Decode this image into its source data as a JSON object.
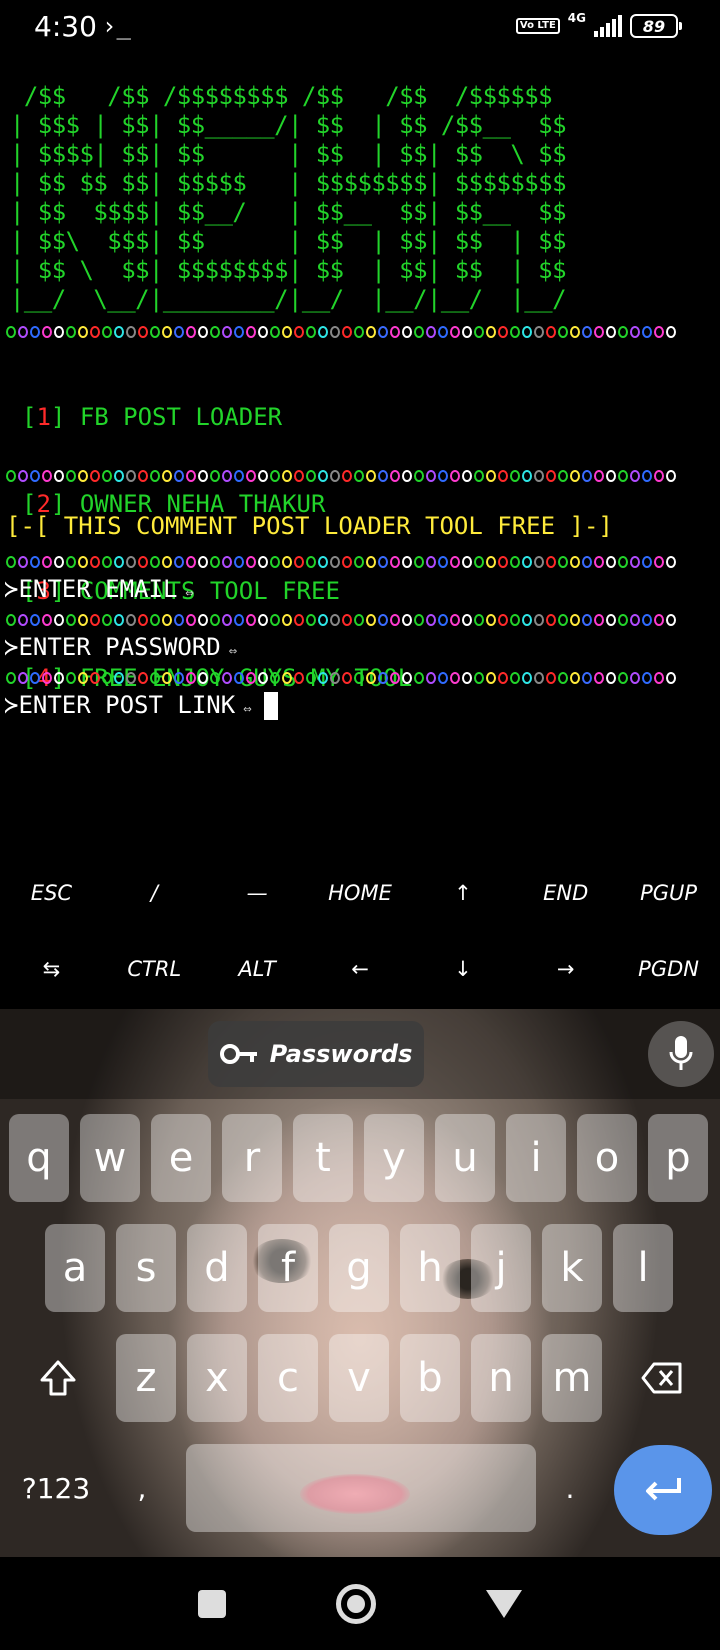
{
  "status_bar": {
    "time": "4:30",
    "terminal_glyph": "›_",
    "volte": "Vo LTE",
    "network": "4G",
    "battery": "89"
  },
  "terminal": {
    "banner_lines": [
      " /$$   /$$ /$$$$$$$$ /$$   /$$  /$$$$$$",
      "| $$$ | $$| $$_____/| $$  | $$ /$$__  $$",
      "| $$$$| $$| $$      | $$  | $$| $$  \\ $$",
      "| $$ $$ $$| $$$$$   | $$$$$$$$| $$$$$$$$",
      "| $$  $$$$| $$__/   | $$__  $$| $$__  $$",
      "| $$\\  $$$| $$      | $$  | $$| $$  | $$",
      "| $$ \\  $$| $$$$$$$$| $$  | $$| $$  | $$",
      "|__/  \\__/|________/|__/  |__/|__/  |__/"
    ],
    "menu": [
      {
        "num": "1",
        "label": "FB POST LOADER"
      },
      {
        "num": "2",
        "label": "OWNER NEHA THAKUR"
      },
      {
        "num": "3",
        "label": "COMMENTS TOOL FREE"
      },
      {
        "num": "4",
        "label": "FREE ENJOY GUYS MY TOOL"
      }
    ],
    "headline": "[-[ THIS COMMENT POST LOADER TOOL FREE ]-]",
    "prompts": {
      "email": "ENTER EMAIL",
      "password": "ENTER PASSWORD",
      "post_link": "ENTER POST LINK"
    },
    "prompt_arrow": "≻",
    "prompt_symbol": "⇔",
    "dot_colors": [
      "#22d42a",
      "#b04cff",
      "#2f6bff",
      "#ff3ad0",
      "#ffffff",
      "#22d42a",
      "#ffeb3b",
      "#ff2a2a",
      "#22d42a",
      "#2ee6e6",
      "#888888",
      "#ff2a2a",
      "#22d42a",
      "#ffeb3b",
      "#3a6bff",
      "#ff3ad0",
      "#ffffff"
    ]
  },
  "extra_keys": {
    "row1": [
      "ESC",
      "/",
      "—",
      "HOME",
      "↑",
      "END",
      "PGUP"
    ],
    "row2": [
      "⇆",
      "CTRL",
      "ALT",
      "←",
      "↓",
      "→",
      "PGDN"
    ]
  },
  "keyboard": {
    "passwords_label": "Passwords",
    "row1": [
      "q",
      "w",
      "e",
      "r",
      "t",
      "y",
      "u",
      "i",
      "o",
      "p"
    ],
    "row2": [
      "a",
      "s",
      "d",
      "f",
      "g",
      "h",
      "j",
      "k",
      "l"
    ],
    "row3": [
      "z",
      "x",
      "c",
      "v",
      "b",
      "n",
      "m"
    ],
    "symbols_label": "?123",
    "comma": ",",
    "period": "."
  }
}
